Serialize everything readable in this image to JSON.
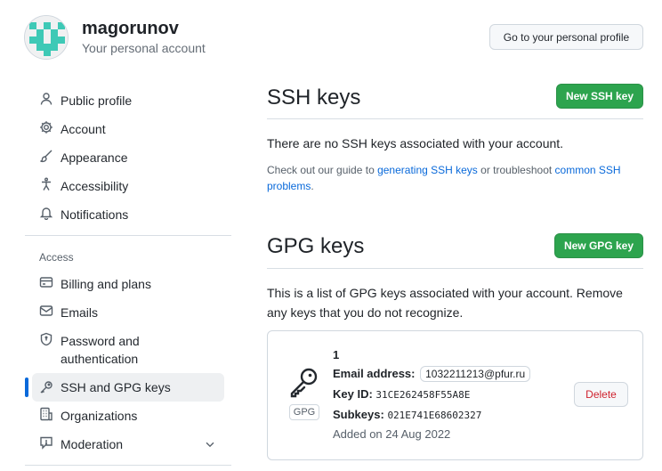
{
  "profile": {
    "username": "magorunov",
    "subtitle": "Your personal account",
    "go_profile_label": "Go to your personal profile"
  },
  "sidebar": {
    "items": [
      {
        "label": "Public profile",
        "icon": "person-icon"
      },
      {
        "label": "Account",
        "icon": "gear-icon"
      },
      {
        "label": "Appearance",
        "icon": "paintbrush-icon"
      },
      {
        "label": "Accessibility",
        "icon": "accessibility-icon"
      },
      {
        "label": "Notifications",
        "icon": "bell-icon"
      }
    ],
    "access_heading": "Access",
    "access_items": [
      {
        "label": "Billing and plans",
        "icon": "credit-card-icon"
      },
      {
        "label": "Emails",
        "icon": "mail-icon"
      },
      {
        "label": "Password and authentication",
        "icon": "shield-lock-icon"
      },
      {
        "label": "SSH and GPG keys",
        "icon": "key-icon",
        "active": true
      },
      {
        "label": "Organizations",
        "icon": "organization-icon"
      },
      {
        "label": "Moderation",
        "icon": "report-icon"
      }
    ]
  },
  "ssh": {
    "title": "SSH keys",
    "new_button": "New SSH key",
    "empty_text": "There are no SSH keys associated with your account.",
    "help_prefix": "Check out our guide to ",
    "help_link1": "generating SSH keys",
    "help_middle": " or troubleshoot ",
    "help_link2": "common SSH problems",
    "help_suffix": "."
  },
  "gpg": {
    "title": "GPG keys",
    "new_button": "New GPG key",
    "description": "This is a list of GPG keys associated with your account. Remove any keys that you do not recognize.",
    "key": {
      "name": "1",
      "badge": "GPG",
      "email_label": "Email address:",
      "email": "1032211213@pfur.ru",
      "key_id_label": "Key ID:",
      "key_id": "31CE262458F55A8E",
      "subkeys_label": "Subkeys:",
      "subkeys": "021E741E68602327",
      "added": "Added on 24 Aug 2022",
      "delete_label": "Delete"
    }
  },
  "colors": {
    "primary": "#2da44e",
    "link": "#0969da",
    "danger": "#cf222e",
    "active_bar": "#0969da"
  }
}
